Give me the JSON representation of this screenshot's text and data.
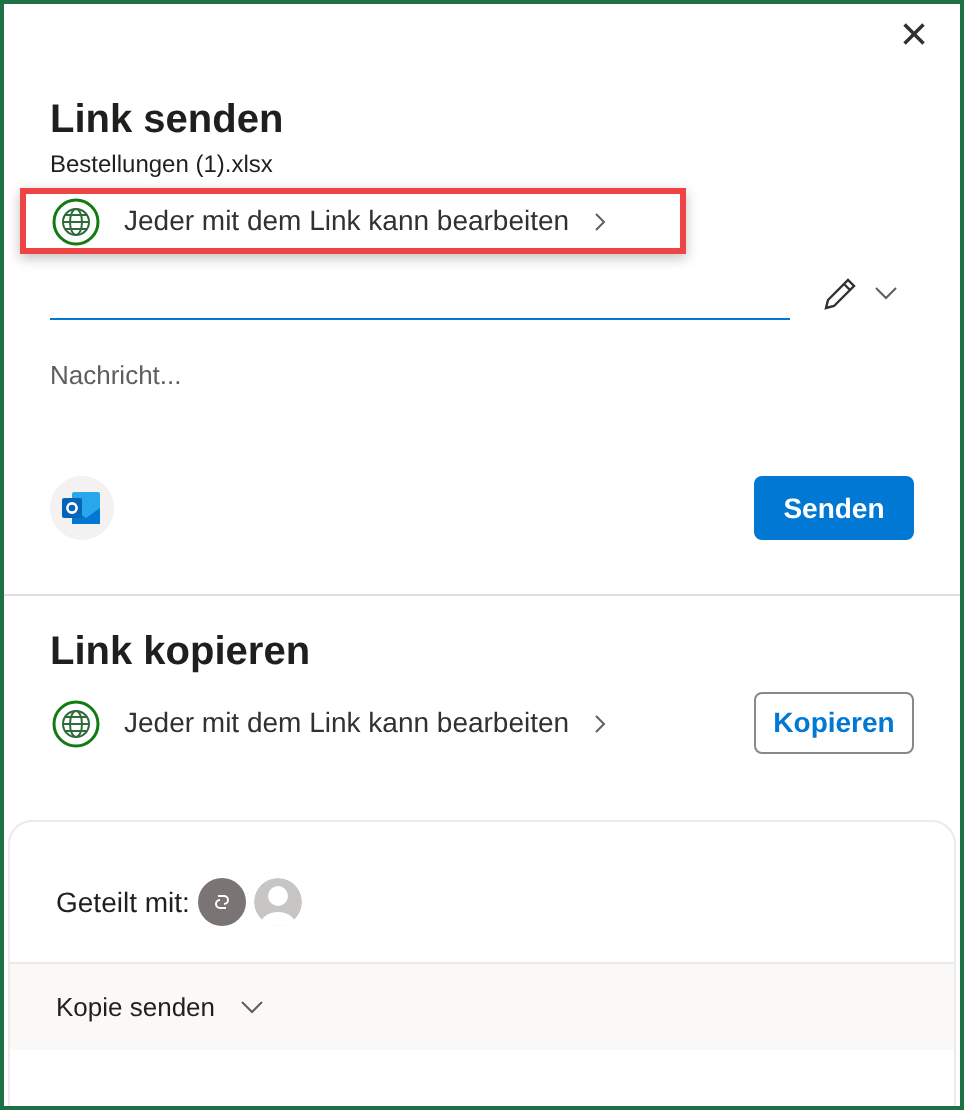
{
  "close": "×",
  "send_link": {
    "title": "Link senden",
    "file_name": "Bestellungen (1).xlsx",
    "permission": {
      "label": "Jeder mit dem Link kann bearbeiten",
      "highlighted": true
    },
    "message": {
      "placeholder": "Nachricht..."
    },
    "send_button": "Senden"
  },
  "copy_link": {
    "title": "Link kopieren",
    "permission": {
      "label": "Jeder mit dem Link kann bearbeiten",
      "highlighted": false
    },
    "copy_button": "Kopieren"
  },
  "shared_with": {
    "label": "Geteilt mit:"
  },
  "footer": {
    "label": "Kopie senden"
  }
}
